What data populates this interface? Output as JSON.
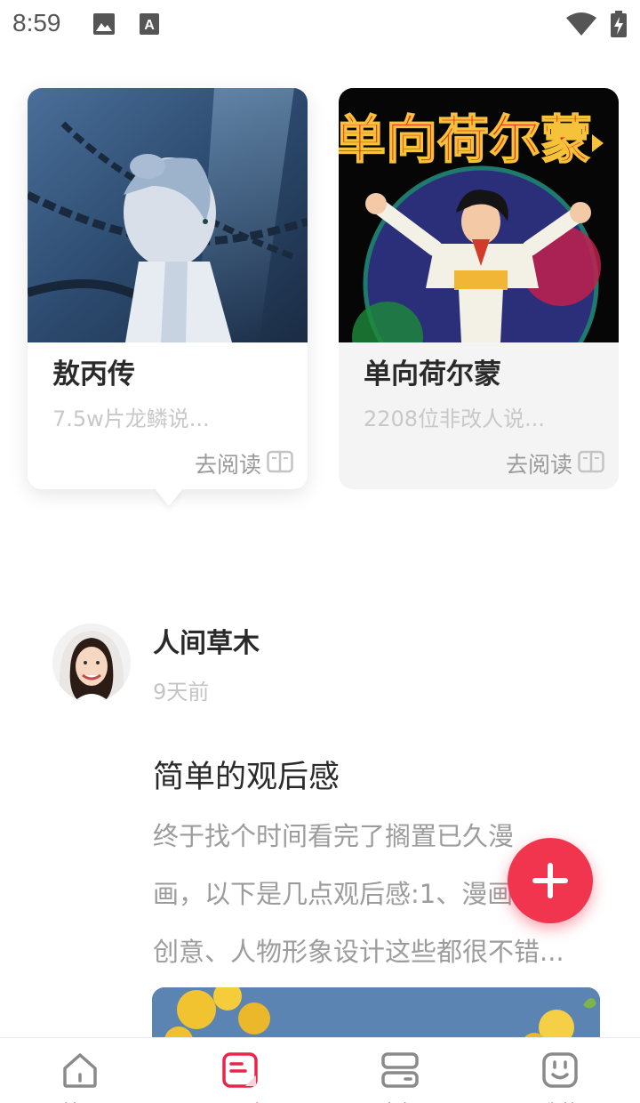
{
  "status_bar": {
    "time": "8:59",
    "icons": [
      "image-icon",
      "text-a-icon",
      "wifi-icon",
      "battery-charging-icon"
    ]
  },
  "cards": [
    {
      "title": "敖丙传",
      "subtitle": "7.5w片龙鳞说...",
      "read_label": "去阅读",
      "selected": true
    },
    {
      "title": "单向荷尔蒙",
      "subtitle": "2208位非改人说...",
      "read_label": "去阅读",
      "cover_text": "单向荷尔蒙",
      "selected": false
    }
  ],
  "post": {
    "author": "人间草木",
    "time": "9天前",
    "title": "简单的观后感",
    "body_lines": [
      "终于找个时间看完了搁置已久漫",
      "画，以下是几点观后感:1、漫画内",
      "创意、人物形象设计这些都很不错..."
    ]
  },
  "fab": {
    "icon": "plus-icon"
  },
  "bottom_nav": {
    "items": [
      {
        "label": "首页",
        "icon": "home-icon"
      },
      {
        "label": "日刊",
        "icon": "journal-icon",
        "active": true
      },
      {
        "label": "书架",
        "icon": "bookshelf-icon"
      },
      {
        "label": "我的",
        "icon": "face-icon"
      }
    ]
  },
  "colors": {
    "accent": "#e8254a",
    "fab": "#f1354f",
    "muted_text": "#9c9c9c"
  }
}
